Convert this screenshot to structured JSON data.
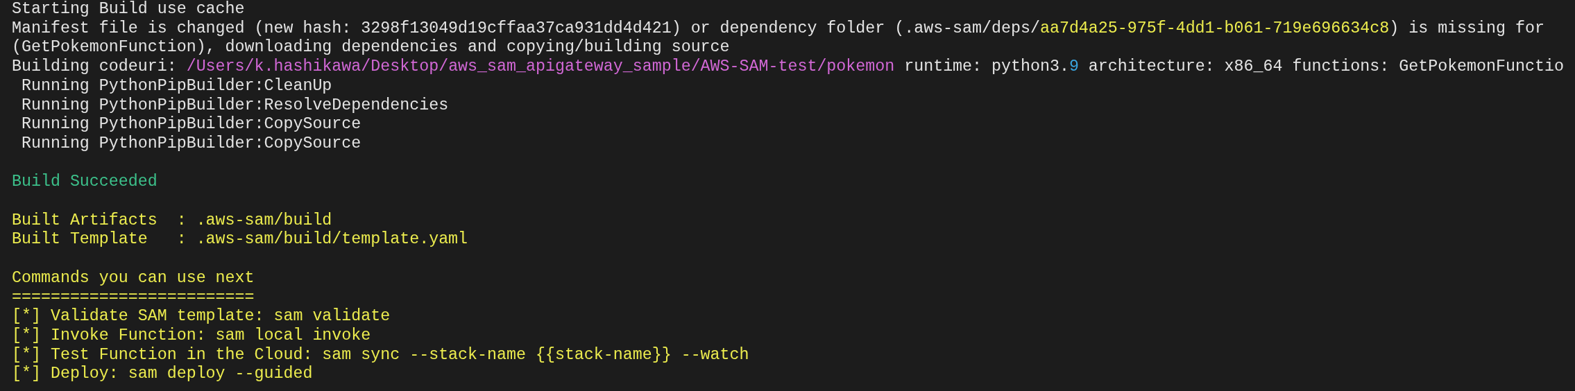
{
  "terminal": {
    "lines": [
      {
        "kind": "text",
        "segments": [
          {
            "kind": "plain",
            "text": "Starting Build use cache"
          }
        ]
      },
      {
        "kind": "text",
        "segments": [
          {
            "kind": "plain",
            "text": "Manifest file is changed (new hash: 3298f13049d19cffaa37ca931dd4d421) or dependency folder (.aws-sam/deps/"
          },
          {
            "kind": "highlight",
            "text": "aa7d4a25-975f-4dd1-b061-719e696634c8"
          },
          {
            "kind": "plain",
            "text": ") is missing for"
          }
        ]
      },
      {
        "kind": "text",
        "segments": [
          {
            "kind": "plain",
            "text": "(GetPokemonFunction), downloading dependencies and copying/building source"
          }
        ]
      },
      {
        "kind": "text",
        "segments": [
          {
            "kind": "plain",
            "text": "Building codeuri: "
          },
          {
            "kind": "path",
            "text": "/Users/k.hashikawa/Desktop/aws_sam_apigateway_sample/AWS-SAM-test/pokemon"
          },
          {
            "kind": "plain",
            "text": " runtime: python3."
          },
          {
            "kind": "number",
            "text": "9"
          },
          {
            "kind": "plain",
            "text": " architecture: x86_64 functions: GetPokemonFunctio"
          }
        ]
      },
      {
        "kind": "text",
        "segments": [
          {
            "kind": "plain",
            "text": " Running PythonPipBuilder:CleanUp"
          }
        ]
      },
      {
        "kind": "text",
        "segments": [
          {
            "kind": "plain",
            "text": " Running PythonPipBuilder:ResolveDependencies"
          }
        ]
      },
      {
        "kind": "text",
        "segments": [
          {
            "kind": "plain",
            "text": " Running PythonPipBuilder:CopySource"
          }
        ]
      },
      {
        "kind": "text",
        "segments": [
          {
            "kind": "plain",
            "text": " Running PythonPipBuilder:CopySource"
          }
        ]
      },
      {
        "kind": "blank"
      },
      {
        "kind": "text",
        "segments": [
          {
            "kind": "success",
            "text": "Build Succeeded"
          }
        ]
      },
      {
        "kind": "blank"
      },
      {
        "kind": "text",
        "segments": [
          {
            "kind": "highlight",
            "text": "Built Artifacts  : .aws-sam/build"
          }
        ]
      },
      {
        "kind": "text",
        "segments": [
          {
            "kind": "highlight",
            "text": "Built Template   : .aws-sam/build/template.yaml"
          }
        ]
      },
      {
        "kind": "blank"
      },
      {
        "kind": "text",
        "segments": [
          {
            "kind": "highlight",
            "text": "Commands you can use next"
          }
        ]
      },
      {
        "kind": "text",
        "segments": [
          {
            "kind": "highlight",
            "text": "========================="
          }
        ]
      },
      {
        "kind": "text",
        "segments": [
          {
            "kind": "highlight",
            "text": "[*] Validate SAM template: sam validate"
          }
        ]
      },
      {
        "kind": "text",
        "segments": [
          {
            "kind": "highlight",
            "text": "[*] Invoke Function: sam local invoke"
          }
        ]
      },
      {
        "kind": "text",
        "segments": [
          {
            "kind": "highlight",
            "text": "[*] Test Function in the Cloud: sam sync --stack-name {{stack-name}} --watch"
          }
        ]
      },
      {
        "kind": "text",
        "segments": [
          {
            "kind": "highlight",
            "text": "[*] Deploy: sam deploy --guided"
          }
        ]
      }
    ]
  }
}
